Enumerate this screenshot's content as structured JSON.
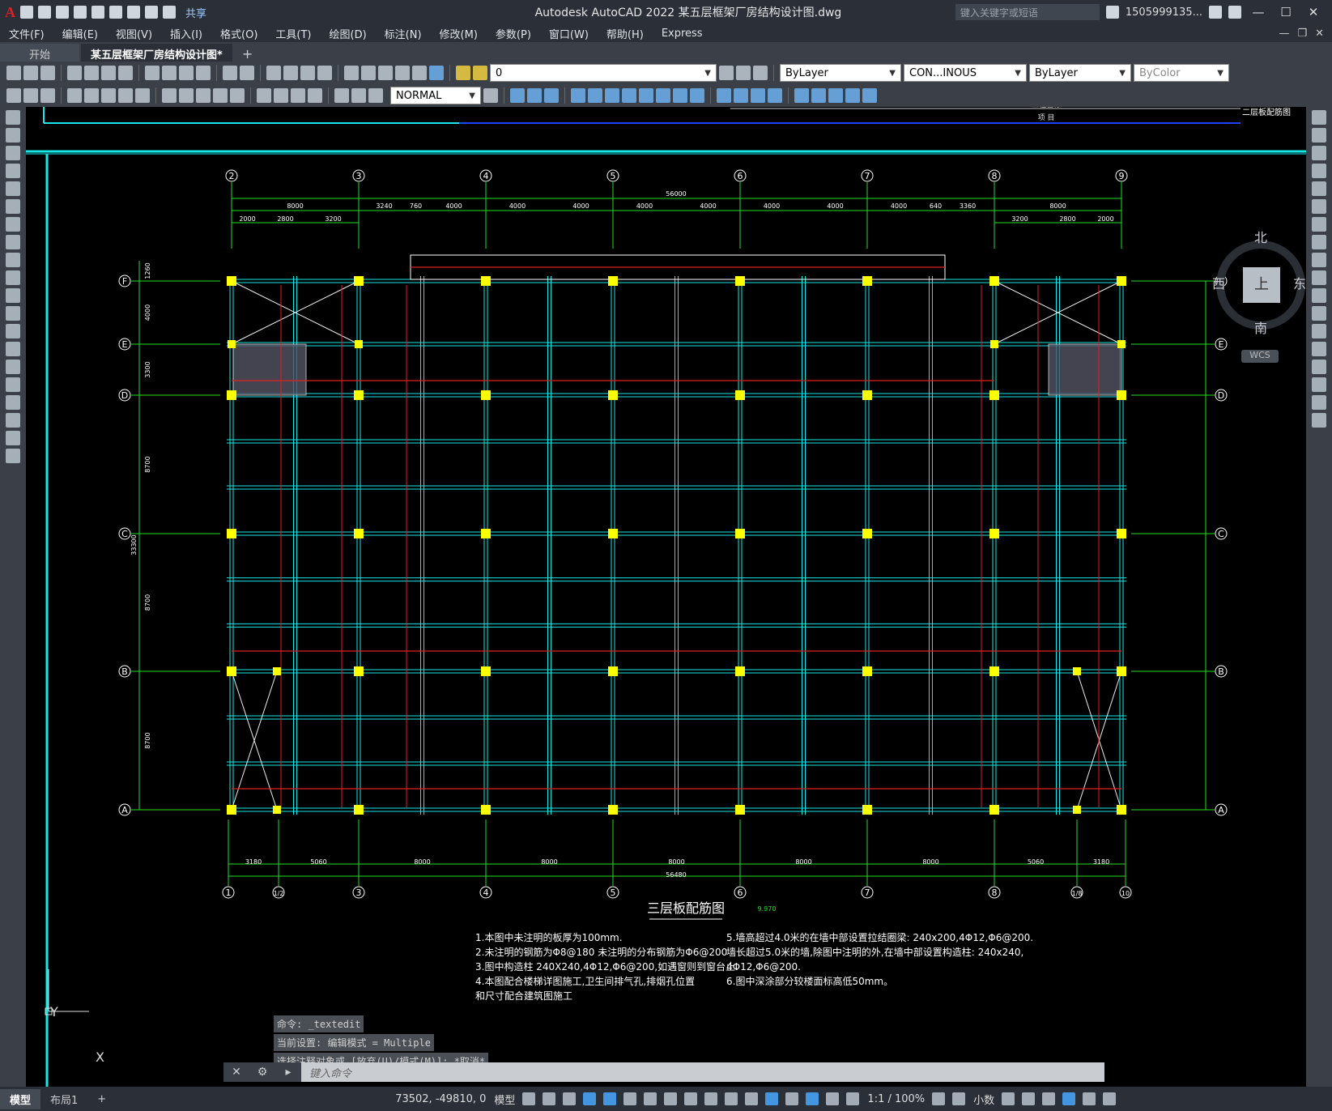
{
  "app": {
    "logo": "A",
    "share": "共享",
    "title": "Autodesk AutoCAD 2022    某五层框架厂房结构设计图.dwg",
    "search_placeholder": "键入关键字或短语",
    "user": "1505999135...",
    "win_min": "—",
    "win_max": "☐",
    "win_close": "✕"
  },
  "menu": [
    "文件(F)",
    "编辑(E)",
    "视图(V)",
    "插入(I)",
    "格式(O)",
    "工具(T)",
    "绘图(D)",
    "标注(N)",
    "修改(M)",
    "参数(P)",
    "窗口(W)",
    "帮助(H)",
    "Express"
  ],
  "tabs": {
    "start": "开始",
    "active": "某五层框架厂房结构设计图*",
    "add": "+"
  },
  "toolbar1": {
    "layer_value": "0",
    "color_value": "ByLayer",
    "linetype_value": "CON...INOUS",
    "lineweight_value": "ByLayer",
    "plotstyle_value": "ByColor"
  },
  "toolbar2": {
    "dimstyle_value": "NORMAL"
  },
  "viewcube": {
    "north": "北",
    "south": "南",
    "east": "东",
    "west": "西",
    "face": "上",
    "wcs": "WCS"
  },
  "drawing": {
    "title": "三层板配筋图",
    "title_level": "9.970",
    "titleblock_right": "二层板配筋图",
    "titleblock_row1": "工程名称",
    "titleblock_row2": "项  目",
    "top_axes": [
      "2",
      "3",
      "4",
      "5",
      "6",
      "7",
      "8",
      "9"
    ],
    "bottom_axes": [
      "1",
      "1/2",
      "3",
      "4",
      "5",
      "6",
      "7",
      "8",
      "1/8",
      "10"
    ],
    "left_axes": [
      "F",
      "E",
      "D",
      "C",
      "B",
      "A"
    ],
    "top_total": "56000",
    "top_dims": [
      "8000",
      "3240",
      "760",
      "4000",
      "4000",
      "4000",
      "4000",
      "4000",
      "4000",
      "4000",
      "4000",
      "640",
      "3360",
      "8000"
    ],
    "top_subdims": [
      "2000",
      "2800",
      "3200",
      "3200",
      "2800",
      "2000"
    ],
    "bottom_total": "56480",
    "bottom_dims": [
      "3180",
      "5060",
      "8000",
      "8000",
      "8000",
      "8000",
      "8000",
      "5060",
      "3180"
    ],
    "left_total": "33300",
    "left_dims": [
      "1260",
      "4000",
      "3300",
      "8700",
      "8700",
      "8700"
    ],
    "notes_left": [
      "1.本图中未注明的板厚为100mm.",
      "2.未注明的钢筋为Φ8@180   未注明的分布钢筋为Φ6@200",
      "3.图中构造柱 240X240,4Φ12,Φ6@200,如遇窗则到窗台止.",
      "4.本图配合楼梯详图施工,卫生间排气孔,排烟孔位置",
      "   和尺寸配合建筑图施工"
    ],
    "notes_right": [
      "5.墙高超过4.0米的在墙中部设置拉结圈梁: 240x200,4Φ12,Φ6@200.",
      "   墙长超过5.0米的墙,除图中注明的外,在墙中部设置构造柱: 240x240,",
      "   4Φ12,Φ6@200.",
      "6.图中深涂部分较楼面标高低50mm。"
    ]
  },
  "ucs": {
    "x": "X",
    "y": "Y"
  },
  "command": {
    "history": [
      "命令: _textedit",
      "当前设置: 编辑模式 = Multiple",
      "选择注释对象或 [放弃(U)/模式(M)]: *取消*"
    ],
    "placeholder": "键入命令"
  },
  "status": {
    "model_tab": "模型",
    "layout_tab": "布局1",
    "add": "+",
    "coords": "73502, -49810, 0",
    "space": "模型",
    "scale": "1:1 / 100%",
    "units": "小数"
  },
  "colors": {
    "grid_cyan": "#19e6e6",
    "axis_green": "#22dd22",
    "column_yellow": "#ffff00",
    "rebar_red": "#e02020",
    "ui_dark": "#2b3038",
    "ui_mid": "#3b4048"
  }
}
